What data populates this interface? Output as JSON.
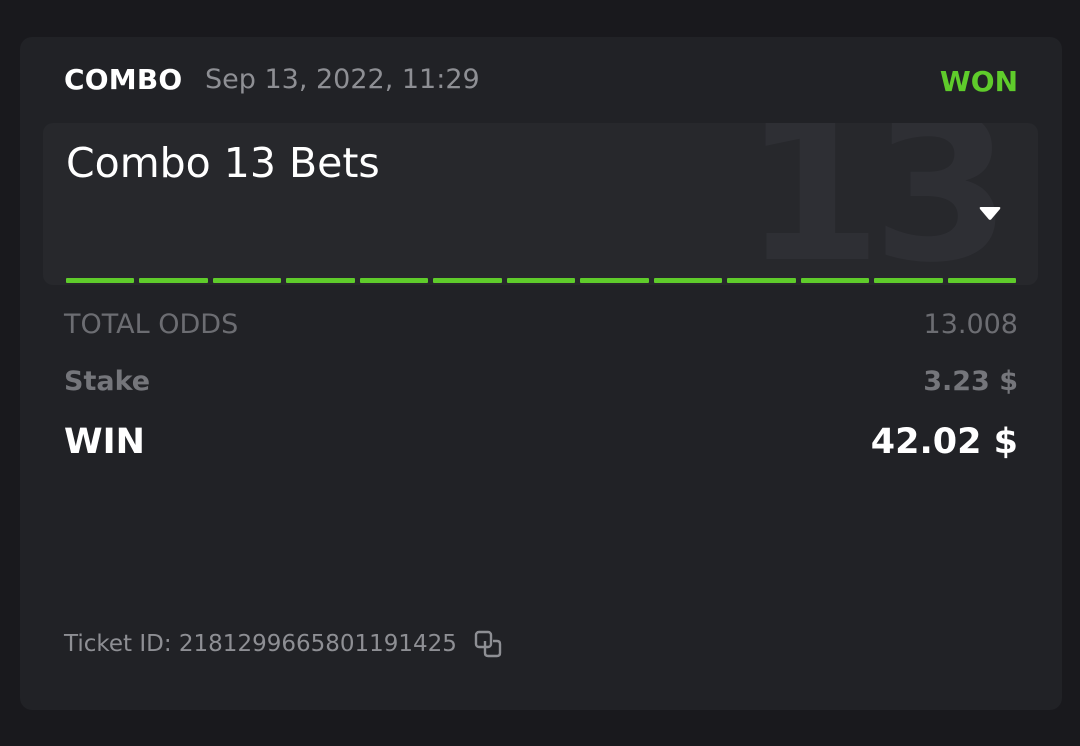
{
  "header": {
    "bet_type": "COMBO",
    "date": "Sep 13, 2022, 11:29",
    "status": "WON",
    "status_color": "#5fcc2b"
  },
  "combo": {
    "title": "Combo 13 Bets",
    "watermark": "13",
    "legs_won": 13,
    "legs_total": 13,
    "expand_icon": "chevron-down-icon"
  },
  "summary": {
    "odds_label": "TOTAL ODDS",
    "odds_value": "13.008",
    "stake_label": "Stake",
    "stake_value": "3.23 $",
    "win_label": "WIN",
    "win_value": "42.02 $"
  },
  "ticket": {
    "label": "Ticket ID: 2181299665801191425",
    "copy_icon": "copy-icon"
  }
}
